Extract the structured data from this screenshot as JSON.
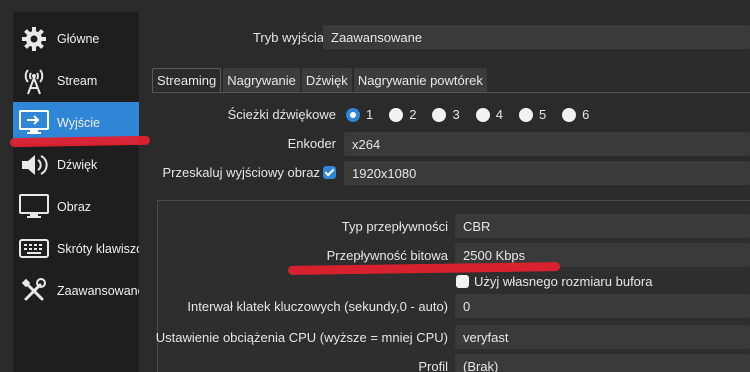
{
  "sidebar": {
    "items": [
      {
        "label": "Główne",
        "icon": "gear-icon"
      },
      {
        "label": "Stream",
        "icon": "broadcast-antenna-icon"
      },
      {
        "label": "Wyjście",
        "icon": "monitor-output-icon"
      },
      {
        "label": "Dźwięk",
        "icon": "speaker-icon"
      },
      {
        "label": "Obraz",
        "icon": "monitor-icon"
      },
      {
        "label": "Skróty klawiszowe",
        "icon": "keyboard-icon"
      },
      {
        "label": "Zaawansowane",
        "icon": "tools-icon"
      }
    ],
    "active_index": 2
  },
  "output_mode": {
    "label": "Tryb wyjścia",
    "value": "Zaawansowane"
  },
  "tabs": [
    {
      "label": "Streaming",
      "active": true
    },
    {
      "label": "Nagrywanie",
      "active": false
    },
    {
      "label": "Dźwięk",
      "active": false
    },
    {
      "label": "Nagrywanie powtórek",
      "active": false
    }
  ],
  "audio_tracks": {
    "label": "Ścieżki dźwiękowe",
    "options": [
      "1",
      "2",
      "3",
      "4",
      "5",
      "6"
    ],
    "selected": "1"
  },
  "encoder": {
    "label": "Enkoder",
    "value": "x264"
  },
  "rescale": {
    "label": "Przeskaluj wyjściowy obraz",
    "checked": true,
    "value": "1920x1080"
  },
  "rate_control": {
    "label": "Typ przepływności",
    "value": "CBR"
  },
  "bitrate": {
    "label": "Przepływność bitowa",
    "value": "2500 Kbps"
  },
  "custom_buffer": {
    "label": "Użyj własnego rozmiaru bufora",
    "checked": false
  },
  "keyframe": {
    "label": "Interwał klatek kluczowych (sekundy,0 - auto)",
    "value": "0"
  },
  "cpu_preset": {
    "label": "Ustawienie obciążenia CPU (wyższe = mniej CPU)",
    "value": "veryfast"
  },
  "profile": {
    "label": "Profil",
    "value": "(Brak)"
  },
  "colors": {
    "accent": "#2f85d6",
    "highlight_mark": "#e1212f",
    "sidebar_bg": "#1e1e1e",
    "panel_bg": "#2b2b2b"
  }
}
